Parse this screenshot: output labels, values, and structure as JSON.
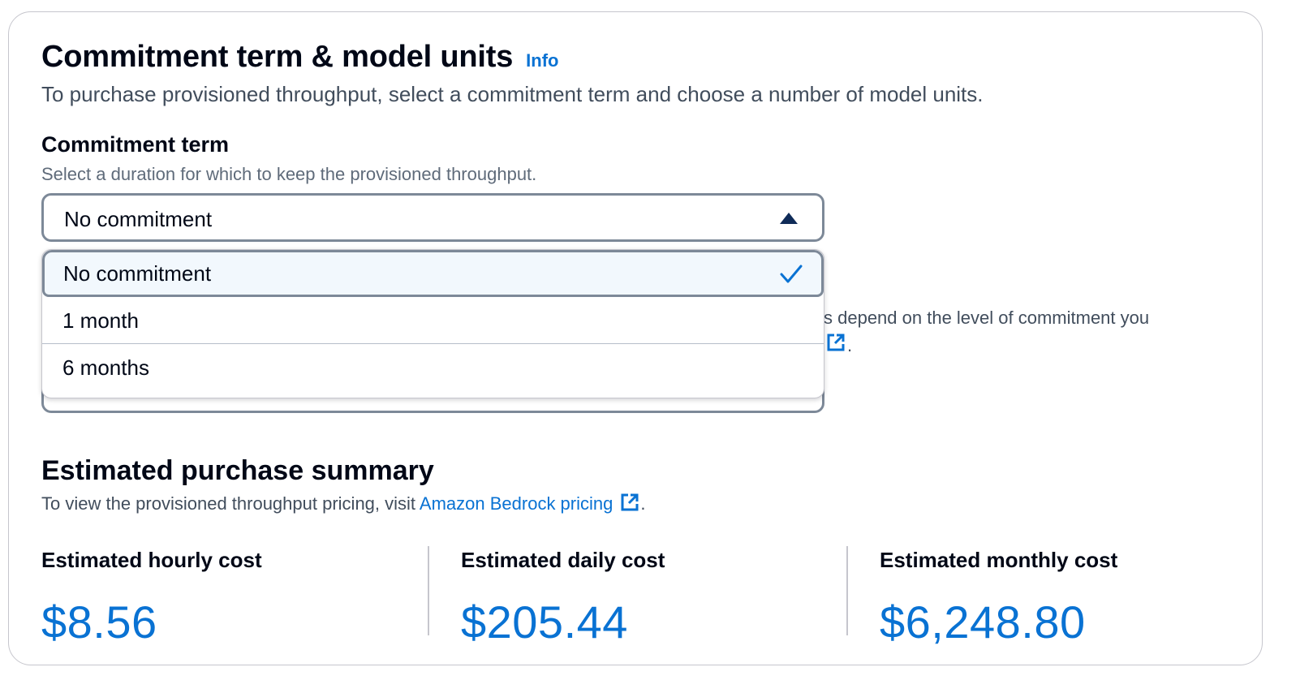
{
  "section": {
    "title": "Commitment term & model units",
    "info_label": "Info",
    "description": "To purchase provisioned throughput, select a commitment term and choose a number of model units."
  },
  "commitment_term": {
    "label": "Commitment term",
    "description": "Select a duration for which to keep the provisioned throughput.",
    "selected_value": "No commitment",
    "options": [
      {
        "label": "No commitment",
        "selected": true
      },
      {
        "label": "1 month",
        "selected": false
      },
      {
        "label": "6 months",
        "selected": false
      }
    ]
  },
  "obscured_field": {
    "partial_text": "s depend on the level of commitment you",
    "partial_suffix": "."
  },
  "summary": {
    "title": "Estimated purchase summary",
    "description_prefix": "To view the provisioned throughput pricing, visit ",
    "pricing_link": "Amazon Bedrock pricing",
    "description_suffix": ".",
    "costs": [
      {
        "label": "Estimated hourly cost",
        "value": "$8.56"
      },
      {
        "label": "Estimated daily cost",
        "value": "$205.44"
      },
      {
        "label": "Estimated monthly cost",
        "value": "$6,248.80"
      }
    ]
  },
  "colors": {
    "link": "#0972d3",
    "text": "#000716",
    "muted": "#414d5c",
    "border": "#7d8998",
    "selected_bg": "#f2f8fd",
    "caret": "#0f2b58"
  },
  "icons": {
    "caret": "caret-up-icon",
    "check": "check-icon",
    "external": "external-link-icon"
  }
}
